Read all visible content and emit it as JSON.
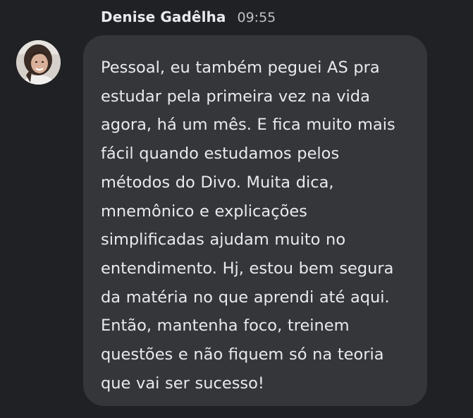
{
  "message": {
    "sender_name": "Denise Gadêlha",
    "time": "09:55",
    "avatar_icon": "user-avatar-photo",
    "text": "Pessoal, eu também peguei AS pra estudar pela primeira vez na vida agora, há um mês. E fica muito mais fácil quando estudamos pelos métodos do Divo. Muita dica, mnemônico e explicações simplificadas ajudam muito no entendimento. Hj, estou bem segura da matéria no que aprendi até aqui. Então, mantenha foco, treinem questões e não fiquem só na teoria que vai ser sucesso!"
  },
  "colors": {
    "background": "#202124",
    "bubble": "#35363a",
    "text": "#e8eaed",
    "time": "#bdc1c6"
  }
}
